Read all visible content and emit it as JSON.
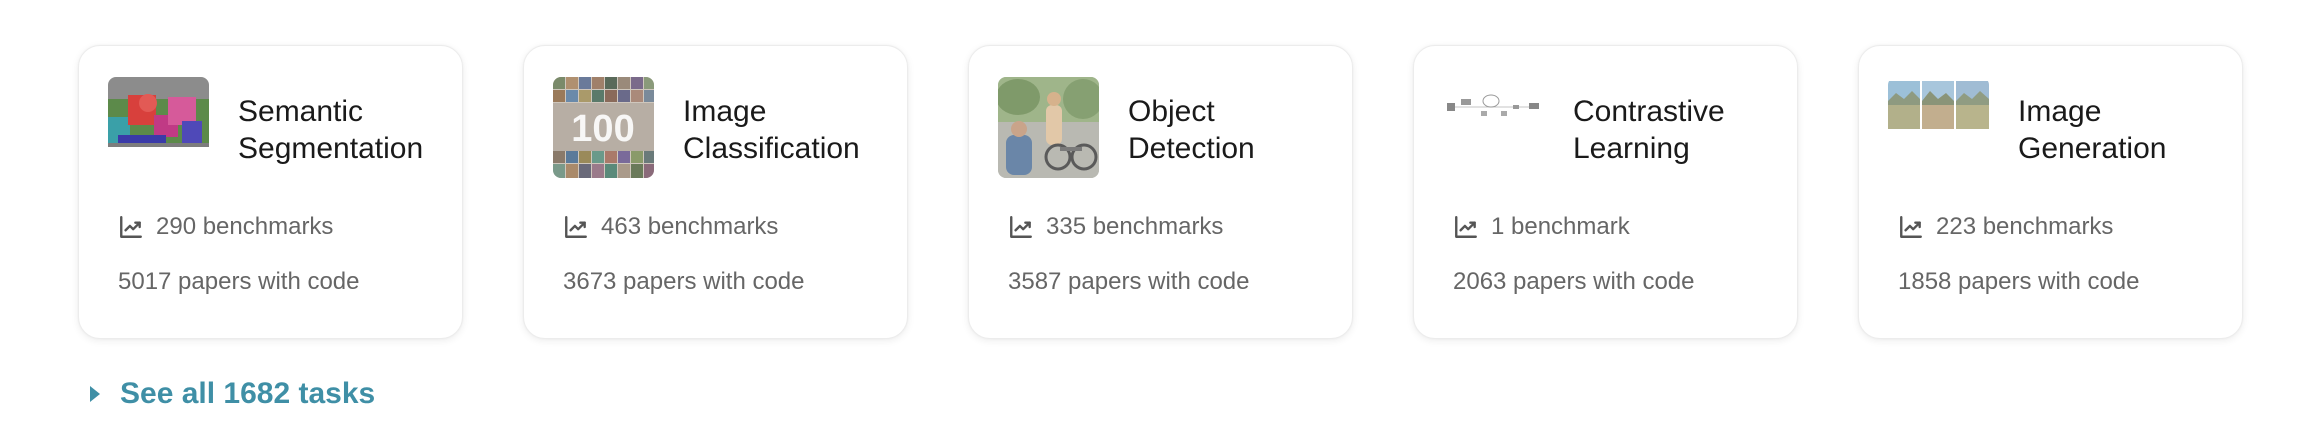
{
  "tasks": [
    {
      "title_line1": "Semantic",
      "title_line2": "Segmentation",
      "benchmarks": "290 benchmarks",
      "papers": "5017 papers with code",
      "thumb_icon": "semantic-segmentation-thumbnail"
    },
    {
      "title_line1": "Image",
      "title_line2": "Classification",
      "benchmarks": "463 benchmarks",
      "papers": "3673 papers with code",
      "thumb_icon": "image-classification-thumbnail"
    },
    {
      "title_line1": "Object",
      "title_line2": "Detection",
      "benchmarks": "335 benchmarks",
      "papers": "3587 papers with code",
      "thumb_icon": "object-detection-thumbnail"
    },
    {
      "title_line1": "Contrastive",
      "title_line2": "Learning",
      "benchmarks": "1 benchmark",
      "papers": "2063 papers with code",
      "thumb_icon": "contrastive-learning-thumbnail"
    },
    {
      "title_line1": "Image",
      "title_line2": "Generation",
      "benchmarks": "223 benchmarks",
      "papers": "1858 papers with code",
      "thumb_icon": "image-generation-thumbnail"
    }
  ],
  "see_all": {
    "label": "See all 1682 tasks"
  },
  "colors": {
    "link": "#3f8fa6",
    "muted_text": "#666666",
    "title_text": "#1a1a1a"
  },
  "icons": {
    "stat": "chart-line-icon",
    "expand": "caret-right-icon"
  }
}
